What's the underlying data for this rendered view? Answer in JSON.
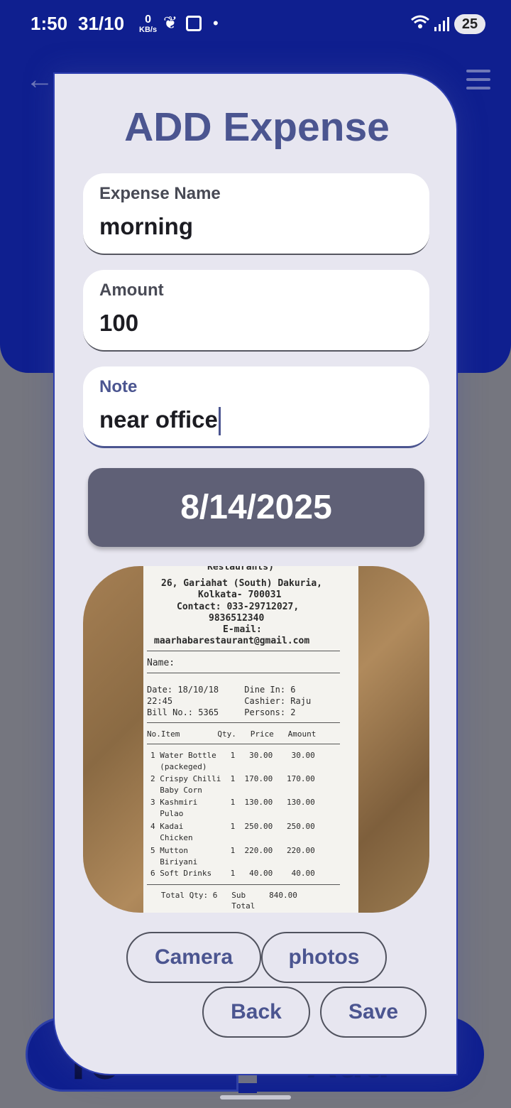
{
  "status_bar": {
    "time": "1:50",
    "date": "31/10",
    "speed_value": "0",
    "speed_unit": "KB/s",
    "dot": "•",
    "battery": "25"
  },
  "background": {
    "back_icon": "←",
    "left_button_partial": "To",
    "right_button_partial": "Add"
  },
  "dialog": {
    "title": "ADD Expense",
    "fields": [
      {
        "label": "Expense Name",
        "value": "morning"
      },
      {
        "label": "Amount",
        "value": "100"
      },
      {
        "label": "Note",
        "value": "near office"
      }
    ],
    "date": "8/14/2025",
    "camera_label": "Camera",
    "photos_label": "photos",
    "back_label": "Back",
    "save_label": "Save"
  },
  "receipt": {
    "header": "Restaurants)",
    "address1": "26, Gariahat (South) Dakuria,",
    "address2": "Kolkata- 700031",
    "contact1": "Contact: 033-29712027,",
    "contact2": "9836512340",
    "email_label": "E-mail:",
    "email": "maarhabarestaurant@gmail.com",
    "name": "Name:",
    "date_line": "Date: 18/10/18     Dine In: 6",
    "time_line": "22:45              Cashier: Raju",
    "bill_line": "Bill No.: 5365     Persons: 2",
    "columns": "No.Item        Qty.   Price   Amount",
    "items": [
      "1 Water Bottle   1   30.00    30.00",
      "  (packeged)",
      "2 Crispy Chilli  1  170.00   170.00",
      "  Baby Corn",
      "3 Kashmiri       1  130.00   130.00",
      "  Pulao",
      "4 Kadai          1  250.00   250.00",
      "  Chicken",
      "5 Mutton         1  220.00   220.00",
      "  Biriyani",
      "6 Soft Drinks    1   40.00    40.00"
    ],
    "total_line": "   Total Qty: 6   Sub     840.00",
    "total_line2": "                  Total"
  },
  "colors": {
    "header_blue": "#0f1f8f",
    "card_bg": "#e7e6f0",
    "accent_text": "#4b5590",
    "date_button": "#5f6076"
  },
  "icons": [
    "back-arrow-icon",
    "menu-icon",
    "leaf-icon",
    "scan-icon",
    "wifi-icon",
    "signal-icon"
  ]
}
